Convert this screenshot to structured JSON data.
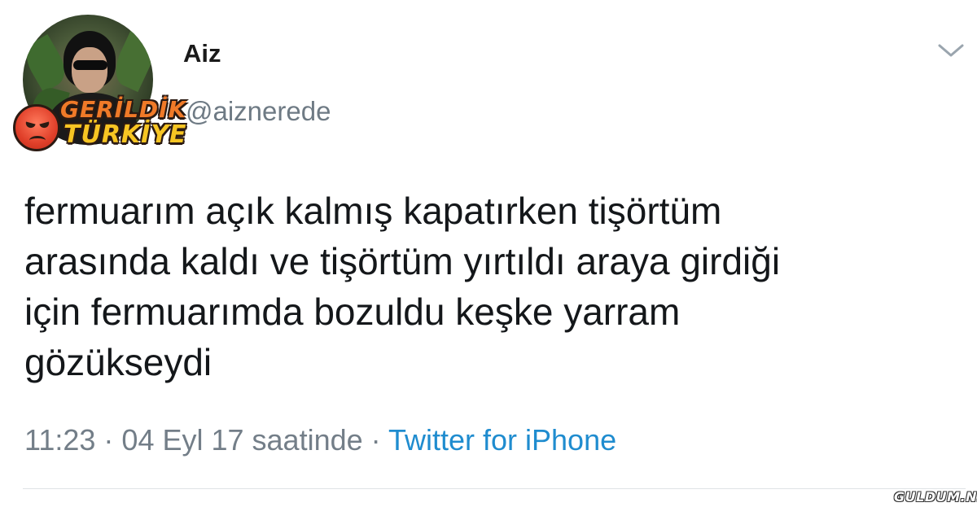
{
  "user": {
    "name": "Aiz",
    "handle": "@aiznerede"
  },
  "logo": {
    "line1": "GERİLDİK",
    "line2": "TÜRKİYE",
    "emoji": "angry-face-icon"
  },
  "tweet": {
    "text": "fermuarım açık kalmış kapatırken tişörtüm\narasında kaldı ve tişörtüm yırtıldı araya girdiği\niçin fermuarımda bozuldu keşke yarram\ngözükseydi"
  },
  "meta": {
    "time": "11:23",
    "date": "04 Eyl 17 saatinde",
    "separator": " · ",
    "source": "Twitter for iPhone"
  },
  "watermark": "GULDUM.NET",
  "colors": {
    "text": "#14171a",
    "secondary": "#737e88",
    "link": "#1f8ccf"
  }
}
